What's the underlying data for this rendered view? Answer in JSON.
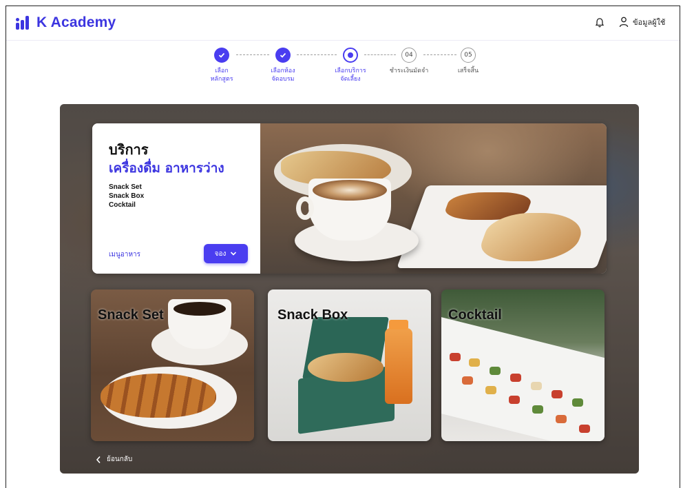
{
  "app": {
    "name": "K Academy",
    "brand_color": "#3c35e0"
  },
  "header": {
    "user_label": "ข้อมูลผู้ใช้",
    "icons": [
      "bell-icon",
      "user-icon"
    ]
  },
  "stepper": {
    "steps": [
      {
        "label_line1": "เลือก",
        "label_line2": "หลักสูตร",
        "status": "done"
      },
      {
        "label_line1": "เลือกห้อง",
        "label_line2": "จัดอบรม",
        "status": "done"
      },
      {
        "label_line1": "เลือกบริการ",
        "label_line2": "จัดเลี้ยง",
        "status": "active"
      },
      {
        "number": "04",
        "label_line1": "ชำระเงินมัดจำ",
        "label_line2": "",
        "status": "todo"
      },
      {
        "number": "05",
        "label_line1": "เสร็จสิ้น",
        "label_line2": "",
        "status": "todo"
      }
    ]
  },
  "service_card": {
    "title": "บริการ",
    "subtitle": "เครื่องดื่ม อาหารว่าง",
    "items": [
      "Snack Set",
      "Snack Box",
      "Cocktail"
    ],
    "menu_link": "เมนูอาหาร",
    "book_label": "จอง"
  },
  "tiles": [
    {
      "title": "Snack Set"
    },
    {
      "title": "Snack  Box"
    },
    {
      "title": "Cocktail"
    }
  ],
  "back_label": "ย้อนกลับ"
}
